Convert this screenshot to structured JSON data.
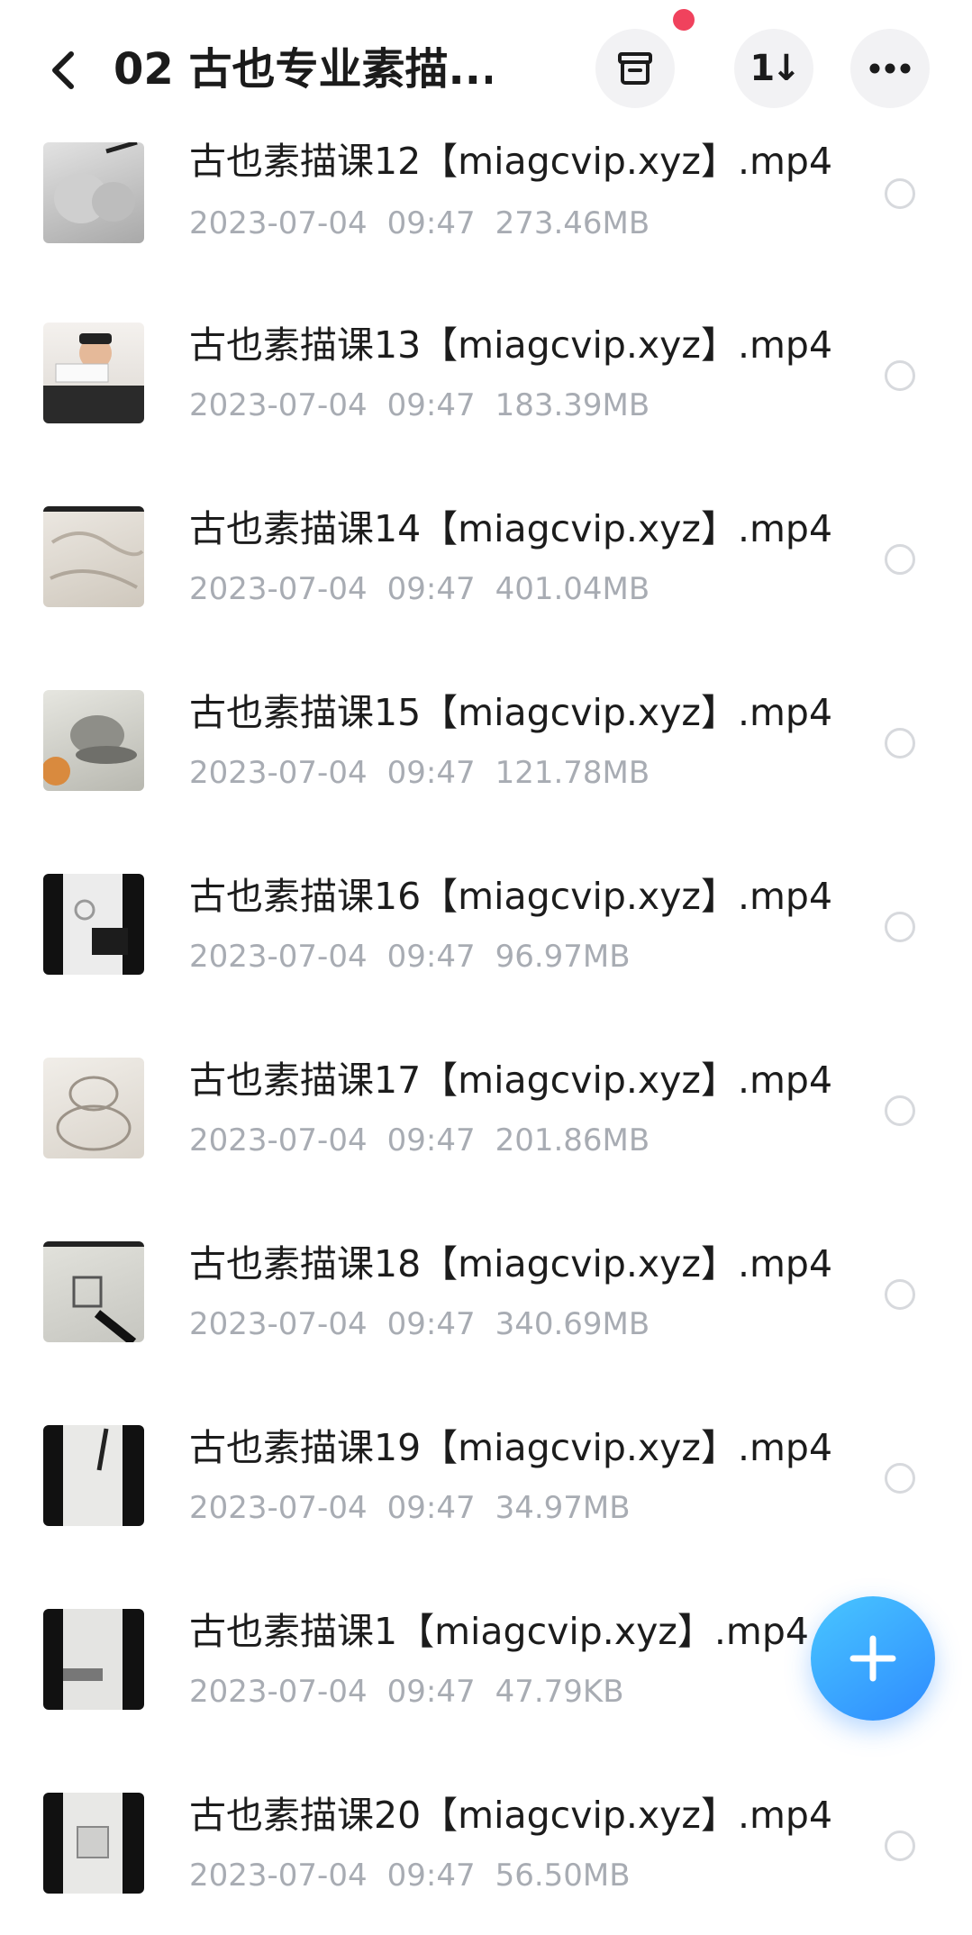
{
  "header": {
    "title": "02 古也专业素描...",
    "back_icon": "chevron-left-icon",
    "buttons": [
      {
        "icon": "archive-box-icon"
      },
      {
        "icon": "sort-icon",
        "glyph": "1↓"
      },
      {
        "icon": "more-dots-icon"
      }
    ],
    "notify_color": "#f0425d"
  },
  "files": [
    {
      "name": "古也素描课12【miagcvip.xyz】.mp4",
      "date": "2023-07-04",
      "time": "09:47",
      "size": "273.46MB"
    },
    {
      "name": "古也素描课13【miagcvip.xyz】.mp4",
      "date": "2023-07-04",
      "time": "09:47",
      "size": "183.39MB"
    },
    {
      "name": "古也素描课14【miagcvip.xyz】.mp4",
      "date": "2023-07-04",
      "time": "09:47",
      "size": "401.04MB"
    },
    {
      "name": "古也素描课15【miagcvip.xyz】.mp4",
      "date": "2023-07-04",
      "time": "09:47",
      "size": "121.78MB"
    },
    {
      "name": "古也素描课16【miagcvip.xyz】.mp4",
      "date": "2023-07-04",
      "time": "09:47",
      "size": "96.97MB"
    },
    {
      "name": "古也素描课17【miagcvip.xyz】.mp4",
      "date": "2023-07-04",
      "time": "09:47",
      "size": "201.86MB"
    },
    {
      "name": "古也素描课18【miagcvip.xyz】.mp4",
      "date": "2023-07-04",
      "time": "09:47",
      "size": "340.69MB"
    },
    {
      "name": "古也素描课19【miagcvip.xyz】.mp4",
      "date": "2023-07-04",
      "time": "09:47",
      "size": "34.97MB"
    },
    {
      "name": "古也素描课1【miagcvip.xyz】.mp4",
      "date": "2023-07-04",
      "time": "09:47",
      "size": "47.79KB"
    },
    {
      "name": "古也素描课20【miagcvip.xyz】.mp4",
      "date": "2023-07-04",
      "time": "09:47",
      "size": "56.50MB"
    }
  ],
  "fab": {
    "icon": "plus-icon",
    "color": "#2f8bff"
  }
}
